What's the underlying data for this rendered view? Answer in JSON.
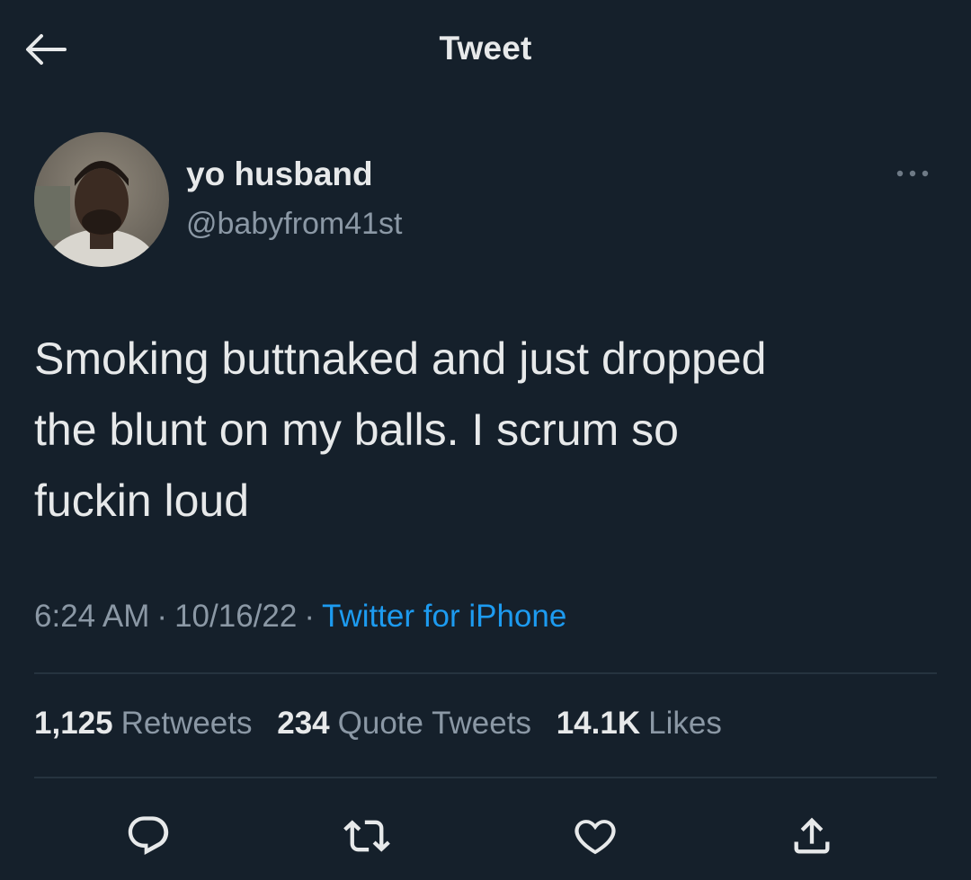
{
  "header": {
    "title": "Tweet",
    "back_icon": "arrow-left-icon"
  },
  "author": {
    "display_name": "yo husband",
    "handle": "@babyfrom41st"
  },
  "tweet": {
    "text": "Smoking buttnaked and just dropped\nthe blunt on my balls. I scrum so\nfuckin loud",
    "time": "6:24 AM",
    "date": "10/16/22",
    "separator": "·",
    "source": "Twitter for iPhone"
  },
  "stats": {
    "retweets_count": "1,125",
    "retweets_label": "Retweets",
    "quotes_count": "234",
    "quotes_label": "Quote Tweets",
    "likes_count": "14.1K",
    "likes_label": "Likes"
  },
  "actions": [
    "reply-icon",
    "retweet-icon",
    "like-icon",
    "share-icon"
  ],
  "colors": {
    "background": "#15202b",
    "text": "#e7e9ea",
    "secondary": "#8b98a5",
    "link": "#1d9bf0",
    "divider": "#26333f"
  }
}
